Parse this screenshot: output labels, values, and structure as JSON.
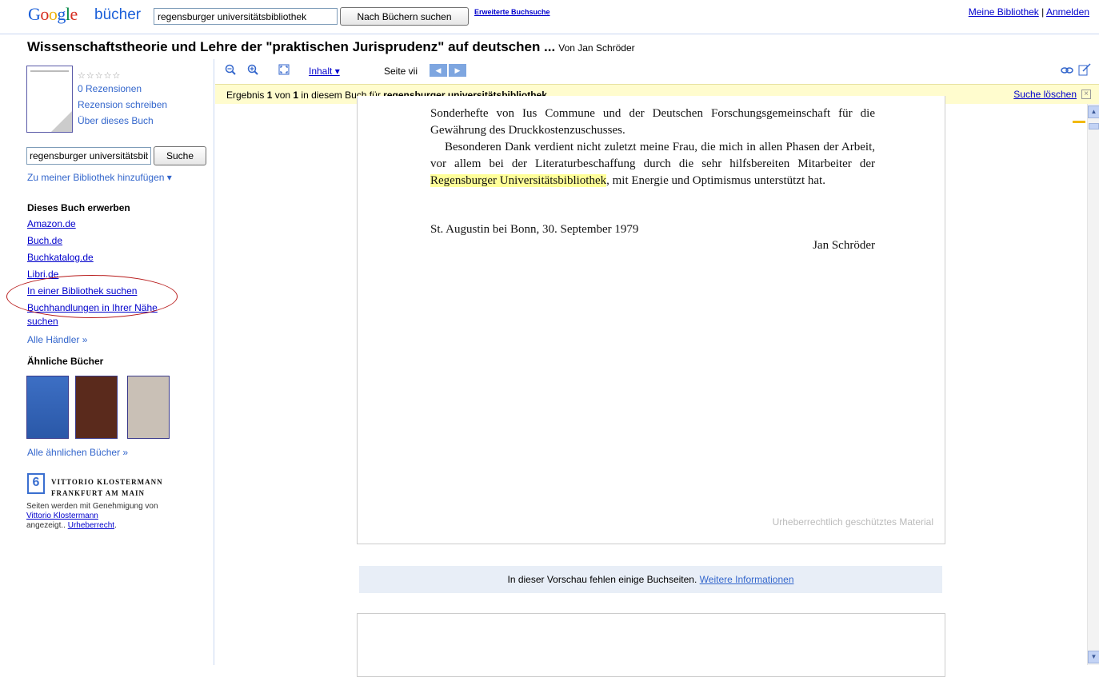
{
  "header": {
    "logo_google": "Google",
    "logo_sub": "bücher",
    "search_value": "regensburger universitätsbibliothek",
    "search_button": "Nach Büchern suchen",
    "advanced_search": "Erweiterte Buchsuche",
    "my_library": "Meine Bibliothek",
    "separator": "|",
    "sign_in": "Anmelden"
  },
  "book": {
    "title": "Wissenschaftstheorie und Lehre der \"praktischen Jurisprudenz\" auf deutschen ...",
    "author": "Von Jan Schröder"
  },
  "sidebar": {
    "stars": "☆☆☆☆☆",
    "reviews": "0 Rezensionen",
    "write_review": "Rezension schreiben",
    "about_book": "Über dieses Buch",
    "search_value": "regensburger universitätsbibliothek",
    "search_button": "Suche",
    "add_to_library": "Zu meiner Bibliothek hinzufügen ▾",
    "buy_heading": "Dieses Buch erwerben",
    "sellers": [
      "Amazon.de",
      "Buch.de",
      "Buchkatalog.de",
      "Libri.de",
      "In einer Bibliothek suchen",
      "Buchhandlungen in Ihrer Nähe",
      "suchen"
    ],
    "all_sellers": "Alle Händler »",
    "similar_heading": "Ähnliche Bücher",
    "all_similar": "Alle ähnlichen Bücher »",
    "publisher_line1": "VITTORIO KLOSTERMANN",
    "publisher_line2": "FRANKFURT AM MAIN",
    "permission_text": "Seiten werden mit Genehmigung von",
    "publisher_link": "Vittorio Klostermann",
    "displayed": "angezeigt..",
    "copyright": "Urheberrecht",
    "period": "."
  },
  "toolbar": {
    "zoom_out_icon": "zoom-out-icon",
    "zoom_in_icon": "zoom-in-icon",
    "fullscreen_icon": "fullscreen-icon",
    "contents": "Inhalt ▾",
    "page_label": "Seite vii",
    "prev": "◀",
    "next": "▶"
  },
  "result": {
    "prefix": "Ergebnis ",
    "num": "1",
    "mid": " von ",
    "total": "1",
    "suffix": " in diesem Buch für ",
    "query": "regensburger universitätsbibliothek",
    "clear": "Suche löschen",
    "clear_x": "×"
  },
  "page": {
    "p1": "Sonderhefte von Ius Commune und der Deutschen Forschungsgemeinschaft für die Gewährung des Druckkostenzuschusses.",
    "p2_a": "Besonderen Dank verdient nicht zuletzt meine Frau, die mich in allen Phasen der Arbeit, vor allem bei der Literaturbeschaffung durch die sehr hilfsbereiten Mitarbeiter der ",
    "p2_hl": "Regensburger Universitätsbibliothek",
    "p2_b": ", mit Energie und Optimismus unterstützt hat.",
    "place_date": "St. Augustin bei Bonn, 30. September 1979",
    "signature": "Jan Schröder",
    "watermark": "Urheberrechtlich geschütztes Material"
  },
  "notice": {
    "text": "In dieser Vorschau fehlen einige Buchseiten. ",
    "link": "Weitere Informationen"
  }
}
